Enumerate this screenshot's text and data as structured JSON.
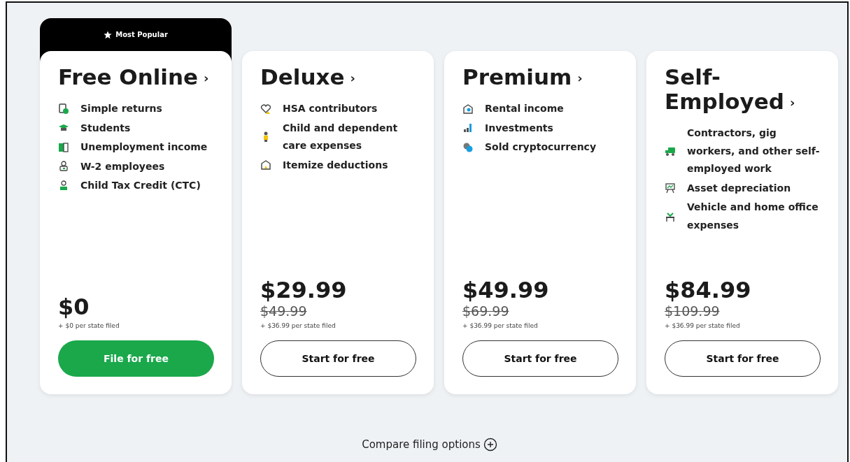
{
  "plans": [
    {
      "badge": "Most Popular",
      "title": "Free Online",
      "title_arrow": "›",
      "features": [
        "Simple returns",
        "Students",
        "Unemployment income",
        "W-2 employees",
        "Child Tax Credit (CTC)"
      ],
      "price": "$0",
      "state_fee": "+ $0 per state filed",
      "button": {
        "label": "File for free",
        "kind": "filled"
      }
    },
    {
      "title": "Deluxe",
      "title_arrow": "›",
      "features": [
        "HSA contributors",
        "Child and dependent care expenses",
        "Itemize deductions"
      ],
      "price": "$29.99",
      "original_price": "$49.99",
      "state_fee": "+ $36.99 per state filed",
      "button": {
        "label": "Start for free",
        "kind": "outline"
      }
    },
    {
      "title": "Premium",
      "title_arrow": "›",
      "features": [
        "Rental income",
        "Investments",
        "Sold cryptocurrency"
      ],
      "price": "$49.99",
      "original_price": "$69.99",
      "state_fee": "+ $36.99 per state filed",
      "button": {
        "label": "Start for free",
        "kind": "outline"
      }
    },
    {
      "title": "Self-Employed",
      "title_arrow": "›",
      "features": [
        "Contractors, gig workers, and other self-employed work",
        "Asset depreciation",
        "Vehicle and home office expenses"
      ],
      "price": "$84.99",
      "original_price": "$109.99",
      "state_fee": "+ $36.99 per state filed",
      "button": {
        "label": "Start for free",
        "kind": "outline"
      }
    }
  ],
  "compare_link": "Compare filing options"
}
